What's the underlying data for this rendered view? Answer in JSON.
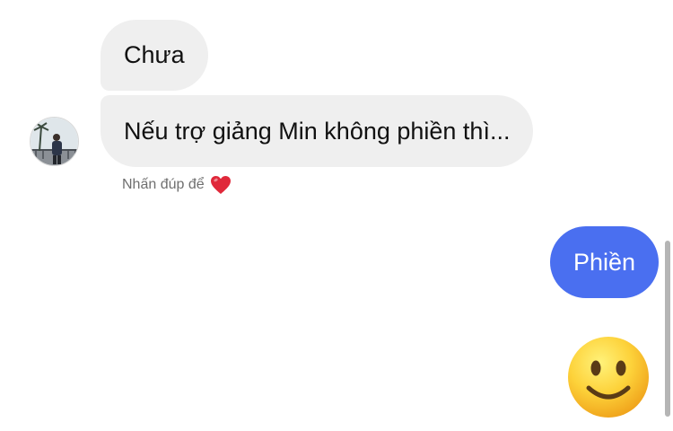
{
  "messages": [
    {
      "sender": "other",
      "text": "Chưa"
    },
    {
      "sender": "other",
      "text": "Nếu trợ giảng Min không phiền thì..."
    },
    {
      "sender": "me",
      "text": "Phiền"
    }
  ],
  "reaction_hint": {
    "text": "Nhấn đúp để",
    "icon": "heart-icon"
  },
  "sent_emoji": "slightly-smiling-face-icon",
  "colors": {
    "incoming_bubble": "#efefef",
    "outgoing_bubble": "#4a6ff0",
    "heart": "#e0283a"
  }
}
